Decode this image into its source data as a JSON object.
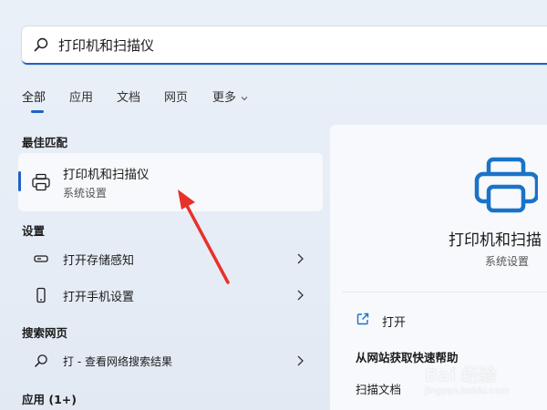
{
  "search": {
    "query": "打印机和扫描仪"
  },
  "tabs": [
    {
      "label": "全部"
    },
    {
      "label": "应用"
    },
    {
      "label": "文档"
    },
    {
      "label": "网页"
    },
    {
      "label": "更多"
    }
  ],
  "best_match": {
    "heading": "最佳匹配",
    "title": "打印机和扫描仪",
    "subtitle": "系统设置",
    "icon": "printer-icon"
  },
  "settings": {
    "heading": "设置",
    "items": [
      {
        "label": "打开存储感知",
        "icon": "storage-icon"
      },
      {
        "label": "打开手机设置",
        "icon": "phone-icon"
      }
    ]
  },
  "web": {
    "heading": "搜索网页",
    "items": [
      {
        "label": "打 - 查看网络搜索结果",
        "icon": "search-icon"
      }
    ]
  },
  "apps": {
    "heading": "应用 (1+)"
  },
  "detail": {
    "title": "打印机和扫描",
    "subtitle": "系统设置",
    "open_label": "打开",
    "help_heading": "从网站获取快速帮助",
    "help_items": [
      "扫描文档"
    ]
  },
  "watermark": {
    "brand": "Bai 经验",
    "url": "jingyan.baidu.com"
  },
  "colors": {
    "accent": "#2062c6",
    "printer_blue": "#1a73c8",
    "arrow_red": "#e8312a"
  }
}
